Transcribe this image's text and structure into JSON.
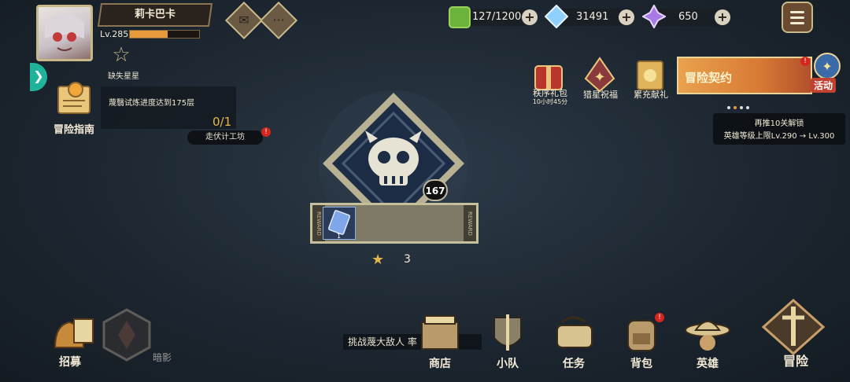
{
  "player": {
    "name": "莉卡巴卡",
    "level": "Lv.285",
    "xp_fraction": 0.55,
    "stars_label": "缺失星星"
  },
  "top_buttons": {
    "mail_icon": "envelope-icon",
    "chat_icon": "chat-bubble-icon"
  },
  "resources": {
    "stamina": "127/1200",
    "crystal": "31491",
    "gem": "650"
  },
  "guide": {
    "label": "冒险指南",
    "task": "蔑翳试炼进度达到175层",
    "progress": "0/1",
    "record_button": "走伏计工坊"
  },
  "events": [
    {
      "label": "秩序礼包",
      "timer": "10小时45分"
    },
    {
      "label": "猎星祝福"
    },
    {
      "label": "累充献礼"
    }
  ],
  "banner": {
    "title": "冒险契约",
    "activity_label": "活动"
  },
  "unlock": {
    "line1": "再推10关解锁",
    "line2": "英雄等级上限Lv.290 → Lv.300"
  },
  "stage": {
    "count": "167",
    "reward_side_label": "REWARD",
    "reward_item_count": "1",
    "star_requirement": "3"
  },
  "bottom_nav": {
    "cue_text": "挑战蔑大敌人 率",
    "items": [
      {
        "label": "招募"
      },
      {
        "label": "暗影"
      },
      {
        "label": "商店"
      },
      {
        "label": "小队"
      },
      {
        "label": "任务"
      },
      {
        "label": "背包"
      },
      {
        "label": "英雄"
      },
      {
        "label": "冒险"
      }
    ]
  },
  "colors": {
    "background": "#1d2731",
    "accent_gold": "#c9b88a",
    "xp_orange": "#e8993a",
    "teal": "#1fb39c",
    "notify_red": "#d4261f"
  }
}
